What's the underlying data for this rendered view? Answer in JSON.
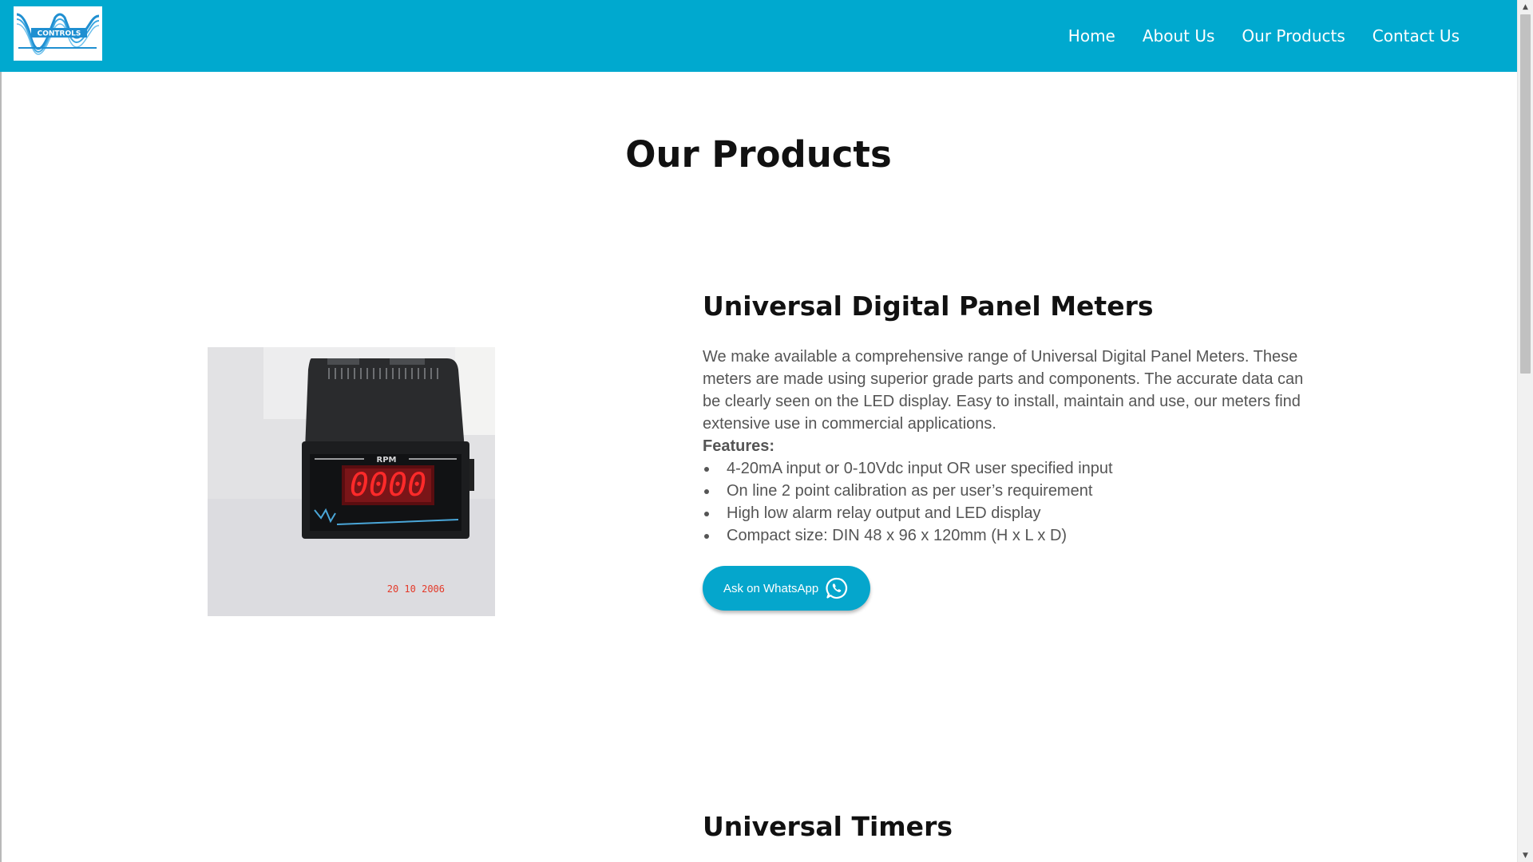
{
  "header": {
    "logo_text": "CONTROLS",
    "nav": [
      {
        "label": "Home"
      },
      {
        "label": "About Us"
      },
      {
        "label": "Our Products"
      },
      {
        "label": "Contact Us"
      }
    ],
    "background_color": "#00a9cf"
  },
  "main": {
    "page_title": "Our Products",
    "products": [
      {
        "title": "Universal Digital Panel Meters",
        "description": "We make available a comprehensive range of Universal Digital Panel Meters. These meters are made using superior grade parts and components. The accurate data can be clearly seen on the LED display. Easy to install, maintain and use, our meters find extensive use in commercial applications.",
        "features_label": "Features:",
        "features": [
          "4-20mA input or 0-10Vdc input OR user specified input",
          "On line 2 point calibration as per user’s requirement",
          "High low alarm relay output and LED display",
          "Compact size: DIN 48 x 96 x 120mm (H x L x D)"
        ],
        "cta_label": "Ask on WhatsApp",
        "cta_icon": "whatsapp-icon",
        "image": {
          "meter_label": "RPM",
          "display_value": "0000",
          "date_stamp": "20 10 2006"
        }
      },
      {
        "title": "Universal Timers"
      }
    ]
  },
  "colors": {
    "accent": "#00a9cf",
    "button": "#05a6cc",
    "heading": "#111111",
    "body_text": "#555555",
    "led": "#ff2a2a"
  }
}
